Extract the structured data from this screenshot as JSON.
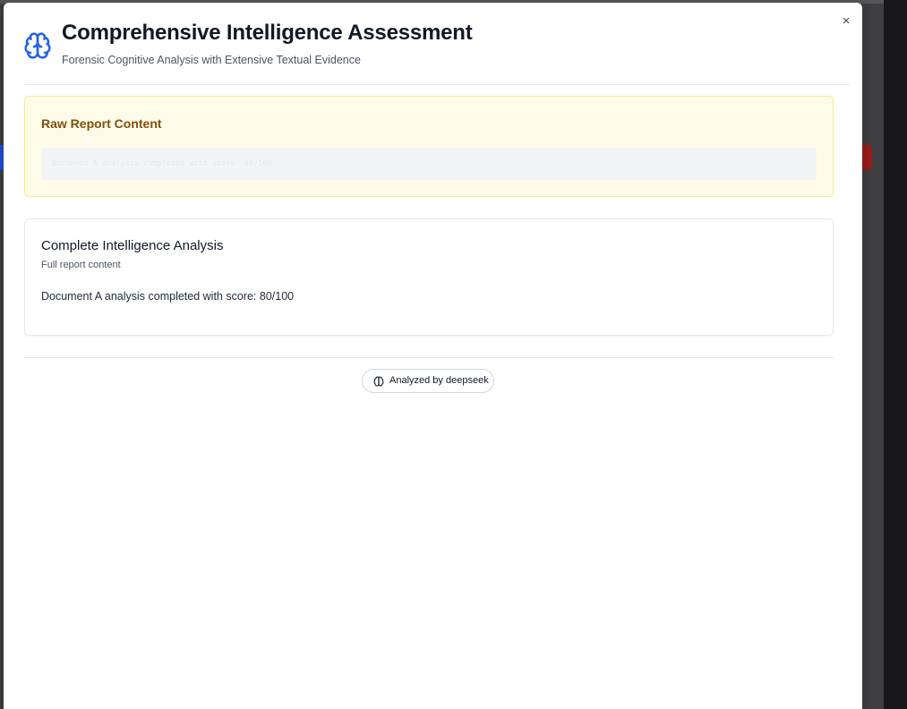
{
  "modal": {
    "close_label": "×",
    "header": {
      "icon": "brain-icon",
      "title": "Comprehensive Intelligence Assessment",
      "subtitle": "Forensic Cognitive Analysis with Extensive Textual Evidence"
    },
    "raw_report": {
      "title": "Raw Report Content",
      "content": "Document A analysis completed with score: 80/100"
    },
    "analysis": {
      "title": "Complete Intelligence Analysis",
      "subtitle": "Full report content",
      "body": "Document A analysis completed with score: 80/100"
    },
    "footer": {
      "badge_icon": "brain-icon",
      "badge_label": "Analyzed by deepseek"
    }
  },
  "colors": {
    "accent": "#2563eb",
    "raw_bg": "#fefce8",
    "raw_border": "#fde68a",
    "raw_title": "#854d0e"
  }
}
